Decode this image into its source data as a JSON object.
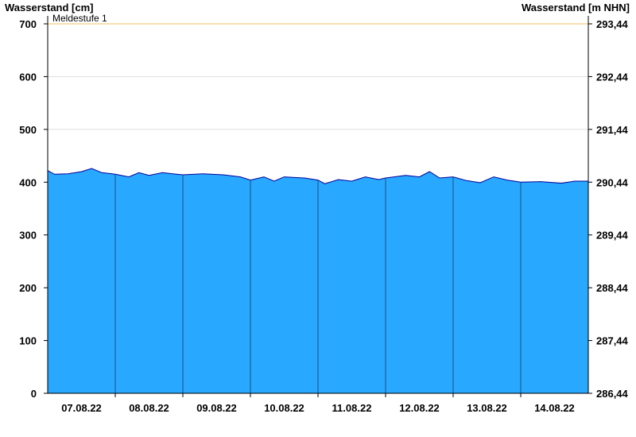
{
  "chart_data": {
    "type": "area",
    "ylabel_left": "Wasserstand [cm]",
    "ylabel_right": "Wasserstand [m NHN]",
    "ylim": [
      0,
      700
    ],
    "yticks_left": [
      "0",
      "100",
      "200",
      "300",
      "400",
      "500",
      "600",
      "700"
    ],
    "yticks_right": [
      "286,44",
      "287,44",
      "288,44",
      "289,44",
      "290,44",
      "291,44",
      "292,44",
      "293,44"
    ],
    "xticks": [
      "07.08.22",
      "08.08.22",
      "09.08.22",
      "10.08.22",
      "11.08.22",
      "12.08.22",
      "13.08.22",
      "14.08.22"
    ],
    "x_range_days": [
      0,
      8
    ],
    "threshold": {
      "label": "Meldestufe 1",
      "value": 700,
      "color": "#f0c060"
    },
    "area_color": "#29a8ff",
    "line_color": "#000099",
    "grid": true,
    "series": [
      {
        "x": [
          0,
          0.1,
          0.3,
          0.5,
          0.65,
          0.8,
          0.95,
          1.0,
          1.2,
          1.35,
          1.5,
          1.7,
          1.85,
          2.0,
          2.3,
          2.6,
          2.85,
          3.0,
          3.2,
          3.35,
          3.5,
          3.8,
          4.0,
          4.1,
          4.3,
          4.5,
          4.7,
          4.9,
          5.0,
          5.3,
          5.5,
          5.65,
          5.8,
          6.0,
          6.2,
          6.4,
          6.6,
          6.8,
          7.0,
          7.3,
          7.6,
          7.8,
          8.0
        ],
        "y": [
          422,
          415,
          416,
          420,
          426,
          418,
          416,
          415,
          410,
          418,
          413,
          418,
          416,
          414,
          416,
          414,
          410,
          404,
          410,
          402,
          410,
          408,
          404,
          397,
          405,
          402,
          410,
          405,
          408,
          413,
          410,
          420,
          408,
          410,
          403,
          399,
          410,
          404,
          400,
          401,
          398,
          402,
          402
        ]
      }
    ]
  }
}
